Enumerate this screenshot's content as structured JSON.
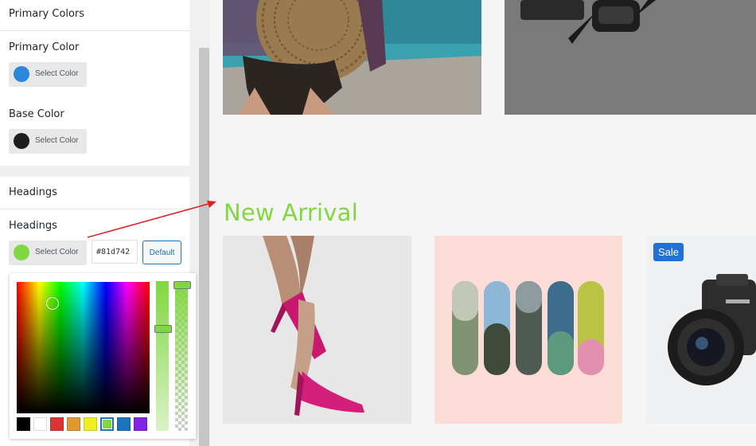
{
  "panel": {
    "primary_colors": {
      "title": "Primary Colors",
      "primary_color": {
        "label": "Primary Color",
        "button": "Select Color",
        "color": "#2b87da"
      },
      "base_color": {
        "label": "Base Color",
        "button": "Select Color",
        "color": "#1d1d1d"
      }
    },
    "headings": {
      "title": "Headings",
      "control_label": "Headings",
      "button": "Select Color",
      "color": "#81d742",
      "hex_value": "#81d742",
      "default_button": "Default"
    },
    "picker": {
      "palette": [
        "#000000",
        "#ffffff",
        "#dd3333",
        "#dd9933",
        "#eeee22",
        "#81d742",
        "#1e73be",
        "#8224e3"
      ],
      "active_swatch": "#81d742",
      "alpha": 1.0
    }
  },
  "preview": {
    "section_heading": "New Arrival",
    "heading_color": "#81d742",
    "sale_badge": "Sale",
    "badge_color": "#2271d6"
  }
}
